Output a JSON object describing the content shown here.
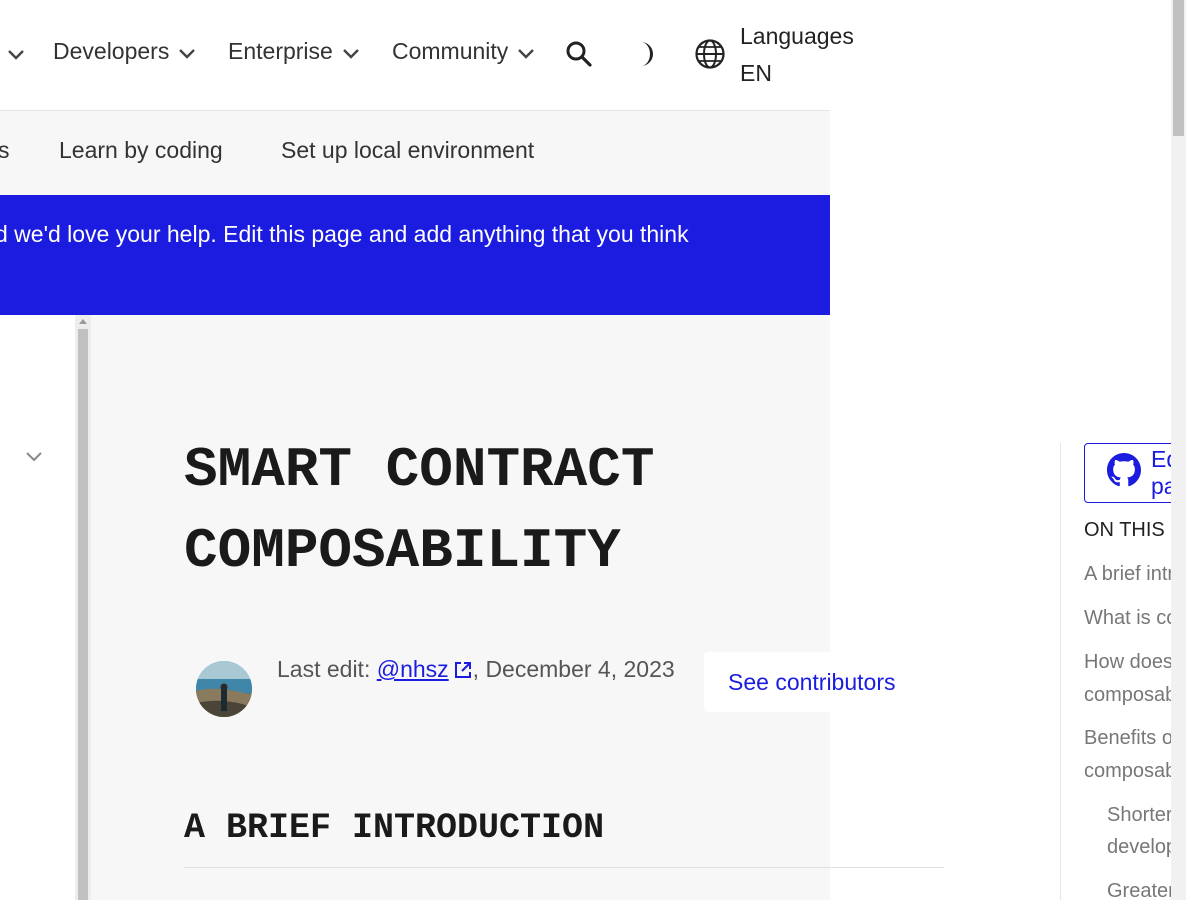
{
  "topnav": {
    "items": [
      {
        "label": "Developers"
      },
      {
        "label": "Enterprise"
      },
      {
        "label": "Community"
      }
    ],
    "languages_label": "Languages",
    "language_code": "EN"
  },
  "subnav": {
    "items": [
      {
        "label": "s"
      },
      {
        "label": "Learn by coding"
      },
      {
        "label": "Set up local environment"
      }
    ]
  },
  "banner": {
    "text": "d we'd love your help. Edit this page and add anything that you think"
  },
  "article": {
    "title_line1": "SMART CONTRACT",
    "title_line2": "COMPOSABILITY",
    "last_edit_prefix": "Last edit: ",
    "last_edit_user": "@nhsz",
    "last_edit_date": ", December 4, 2023",
    "see_contributors": "See contributors",
    "section_heading": "A BRIEF INTRODUCTION"
  },
  "toc": {
    "edit_label": "Edit page",
    "heading": "ON THIS PAGE",
    "items": [
      {
        "label": "A brief introduction"
      },
      {
        "label": "What is composability?"
      },
      {
        "label": "How does composability work?"
      },
      {
        "label": "composability work?"
      },
      {
        "label": "Benefits of composability"
      },
      {
        "label": "composability"
      },
      {
        "label": "Shorter development cycle"
      },
      {
        "label": "development cycle"
      },
      {
        "label": "Greater innovation"
      }
    ]
  },
  "colors": {
    "accent": "#1c1ce1",
    "banner_bg": "#1c1ce1",
    "panel_bg": "#f7f7f7",
    "text": "#333333"
  },
  "icons": [
    "chevron-down-icon",
    "search-icon",
    "theme-toggle-icon",
    "globe-icon",
    "external-link-icon",
    "github-icon"
  ]
}
